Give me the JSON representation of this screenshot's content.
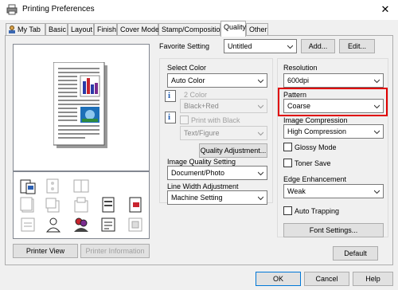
{
  "window": {
    "title": "Printing Preferences",
    "close_glyph": "✕"
  },
  "tabs": [
    {
      "label": "My Tab"
    },
    {
      "label": "Basic"
    },
    {
      "label": "Layout"
    },
    {
      "label": "Finish"
    },
    {
      "label": "Cover Mode"
    },
    {
      "label": "Stamp/Composition"
    },
    {
      "label": "Quality"
    },
    {
      "label": "Other"
    }
  ],
  "left": {
    "printer_view_button": "Printer View",
    "printer_information_button": "Printer Information",
    "icons": [
      "print-options-icon",
      "punch-icon",
      "booklet-icon",
      "staple-icon",
      "document-icon",
      "copy-stack-icon",
      "user-auth-icon",
      "account-track-icon",
      "secure-print-icon",
      "tray-icon"
    ]
  },
  "favorite": {
    "label": "Favorite Setting",
    "value": "Untitled",
    "add_button": "Add...",
    "edit_button": "Edit..."
  },
  "select_color": {
    "label": "Select Color",
    "value": "Auto Color",
    "two_color_label": "2 Color",
    "two_color_value": "Black+Red",
    "print_with_black_label": "Print with Black",
    "text_figure_value": "Text/Figure",
    "quality_adjustment_button": "Quality Adjustment..."
  },
  "image_quality": {
    "label": "Image Quality Setting",
    "value": "Document/Photo"
  },
  "line_width": {
    "label": "Line Width Adjustment",
    "value": "Machine Setting"
  },
  "right": {
    "resolution_label": "Resolution",
    "resolution_value": "600dpi",
    "pattern_label": "Pattern",
    "pattern_value": "Coarse",
    "image_compression_label": "Image Compression",
    "image_compression_value": "High Compression",
    "glossy_mode_label": "Glossy Mode",
    "toner_save_label": "Toner Save",
    "edge_enhancement_label": "Edge Enhancement",
    "edge_enhancement_value": "Weak",
    "auto_trapping_label": "Auto Trapping",
    "font_settings_button": "Font Settings...",
    "default_button": "Default"
  },
  "footer": {
    "ok": "OK",
    "cancel": "Cancel",
    "help": "Help"
  },
  "colors": {
    "highlight": "#e00000",
    "accent": "#1e5cb3"
  }
}
